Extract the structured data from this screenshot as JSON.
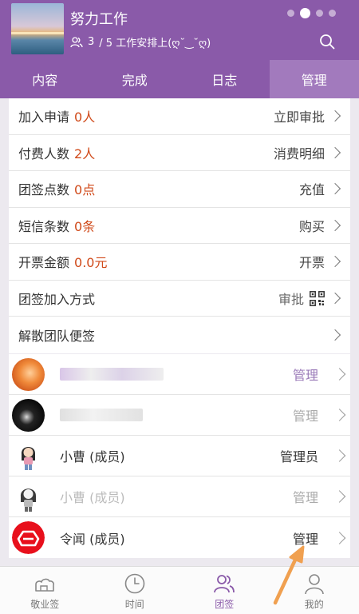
{
  "header": {
    "title": "努力工作",
    "member_count": "3",
    "subtitle": "/ 5 工作安排上(ღ˘‿˘ღ)",
    "cover_icon": "sunset-sea-photo",
    "pager": {
      "count": 4,
      "active_index": 1
    }
  },
  "tabs": [
    {
      "label": "内容",
      "active": false
    },
    {
      "label": "完成",
      "active": false
    },
    {
      "label": "日志",
      "active": false
    },
    {
      "label": "管理",
      "active": true
    }
  ],
  "settings": [
    {
      "label": "加入申请",
      "value": "0人",
      "action": "立即审批"
    },
    {
      "label": "付费人数",
      "value": "2人",
      "action": "消费明细"
    },
    {
      "label": "团签点数",
      "value": "0点",
      "action": "充值"
    },
    {
      "label": "短信条数",
      "value": "0条",
      "action": "购买"
    },
    {
      "label": "开票金额",
      "value": "0.0元",
      "action": "开票"
    },
    {
      "label": "团签加入方式",
      "value": "",
      "action": "审批"
    },
    {
      "label": "解散团队便签",
      "value": "",
      "action": ""
    }
  ],
  "members": [
    {
      "name": "",
      "action": "管理",
      "style": "purple",
      "avatar": "girl-photo-avatar"
    },
    {
      "name": "",
      "action": "管理",
      "style": "light",
      "avatar": "dark-photo-avatar"
    },
    {
      "name": "小曹 (成员)",
      "action": "管理员",
      "style": "dark",
      "avatar": "cartoon-girl-avatar"
    },
    {
      "name": "小曹 (成员)",
      "action": "管理",
      "style": "light",
      "avatar": "cartoon-girl-bw-avatar"
    },
    {
      "name": "令闻 (成员)",
      "action": "管理",
      "style": "dark",
      "avatar": "red-logo-avatar"
    }
  ],
  "bottom_nav": [
    {
      "label": "敬业签",
      "icon": "cloud-note-icon",
      "active": false
    },
    {
      "label": "时间",
      "icon": "clock-icon",
      "active": false
    },
    {
      "label": "团签",
      "icon": "team-icon",
      "active": true
    },
    {
      "label": "我的",
      "icon": "person-icon",
      "active": false
    }
  ],
  "colors": {
    "brand": "#8a5aa9",
    "value": "#d04a1a",
    "annotation_arrow": "#f0a050"
  }
}
